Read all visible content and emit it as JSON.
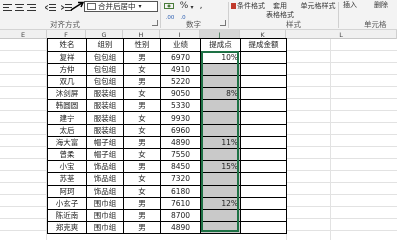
{
  "ribbon": {
    "merge_label": "合并后居中",
    "percent_label": "%",
    "comma_label": ",",
    "inc_decimal_label": ".00",
    "dec_decimal_label": ".0",
    "cond_format_label": "条件格式",
    "table_format_label": "套用",
    "table_format_label2": "表格格式",
    "cell_style_label": "单元格样式",
    "insert_label": "插入",
    "delete_label": "删除",
    "groups": {
      "alignment": "对齐方式",
      "number": "数字",
      "styles": "样式",
      "cells": "单元格"
    }
  },
  "columns": [
    "E",
    "F",
    "G",
    "H",
    "I",
    "J",
    "K",
    "L"
  ],
  "selected_column": "J",
  "table": {
    "headers": [
      "姓名",
      "组别",
      "性别",
      "业绩",
      "提成点",
      "提成金额"
    ],
    "rows": [
      [
        "复祥",
        "包包组",
        "男",
        "6970",
        "10%",
        ""
      ],
      [
        "方仲",
        "包包组",
        "女",
        "4910",
        "",
        ""
      ],
      [
        "双几",
        "包包组",
        "男",
        "5220",
        "",
        ""
      ],
      [
        "沐剑屏",
        "服装组",
        "女",
        "9050",
        "8%",
        ""
      ],
      [
        "韩圆圆",
        "服装组",
        "男",
        "5330",
        "",
        ""
      ],
      [
        "建宁",
        "服装组",
        "女",
        "9930",
        "",
        ""
      ],
      [
        "太后",
        "服装组",
        "女",
        "6960",
        "",
        ""
      ],
      [
        "海大富",
        "帽子组",
        "男",
        "4890",
        "11%",
        ""
      ],
      [
        "曾柔",
        "帽子组",
        "女",
        "7550",
        "",
        ""
      ],
      [
        "小宝",
        "饰品组",
        "男",
        "8450",
        "15%",
        ""
      ],
      [
        "苏荃",
        "饰品组",
        "女",
        "7320",
        "",
        ""
      ],
      [
        "阿珂",
        "饰品组",
        "女",
        "6180",
        "",
        ""
      ],
      [
        "小玄子",
        "围巾组",
        "男",
        "7610",
        "12%",
        ""
      ],
      [
        "陈近南",
        "围巾组",
        "男",
        "8700",
        "",
        ""
      ],
      [
        "郑克爽",
        "围巾组",
        "男",
        "4890",
        "",
        ""
      ]
    ]
  }
}
